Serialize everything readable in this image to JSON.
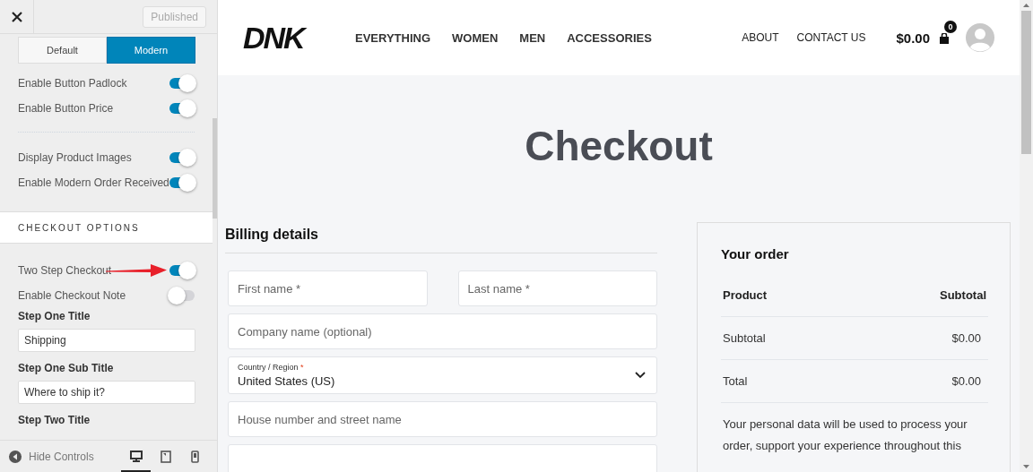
{
  "sidebar": {
    "publish_button": "Published",
    "layout_options": [
      {
        "label": "Default",
        "selected": false
      },
      {
        "label": "Modern",
        "selected": true
      }
    ],
    "settings": [
      {
        "kind": "toggle",
        "label": "Enable Button Padlock",
        "on": true
      },
      {
        "kind": "toggle",
        "label": "Enable Button Price",
        "on": true
      },
      {
        "kind": "divider"
      },
      {
        "kind": "toggle",
        "label": "Display Product Images",
        "on": true
      },
      {
        "kind": "toggle",
        "label": "Enable Modern Order Received",
        "on": true
      },
      {
        "kind": "section",
        "label": "CHECKOUT OPTIONS"
      },
      {
        "kind": "toggle",
        "label": "Two Step Checkout",
        "on": true,
        "annotated": true
      },
      {
        "kind": "toggle",
        "label": "Enable Checkout Note",
        "on": false
      },
      {
        "kind": "text",
        "label": "Step One Title",
        "value": "Shipping"
      },
      {
        "kind": "text",
        "label": "Step One Sub Title",
        "value": "Where to ship it?"
      },
      {
        "kind": "heading",
        "label": "Step Two Title"
      }
    ],
    "footer": {
      "label": "Hide Controls",
      "devices": [
        {
          "kind": "desktop",
          "selected": true
        },
        {
          "kind": "tablet",
          "selected": false
        },
        {
          "kind": "mobile",
          "selected": false
        }
      ]
    }
  },
  "site": {
    "logo": "DNK",
    "nav": [
      "EVERYTHING",
      "WOMEN",
      "MEN",
      "ACCESSORIES"
    ],
    "secondary_nav": [
      "ABOUT",
      "CONTACT US"
    ],
    "cart_total": "$0.00",
    "cart_count": "0"
  },
  "page_title": "Checkout",
  "billing": {
    "title": "Billing details",
    "rows": [
      [
        {
          "kind": "input",
          "placeholder": "First name *"
        },
        {
          "kind": "input",
          "placeholder": "Last name *"
        }
      ],
      [
        {
          "kind": "input",
          "placeholder": "Company name (optional)"
        }
      ],
      [
        {
          "kind": "select",
          "label": "Country / Region",
          "required_mark": "*",
          "value": "United States (US)"
        }
      ],
      [
        {
          "kind": "input",
          "placeholder": "House number and street name"
        }
      ],
      [
        {
          "kind": "input"
        }
      ]
    ]
  },
  "order": {
    "title": "Your order",
    "columns": [
      "Product",
      "Subtotal"
    ],
    "rows": [
      {
        "label": "Subtotal",
        "value": "$0.00"
      },
      {
        "label": "Total",
        "value": "$0.00"
      }
    ],
    "privacy_text": "Your personal data will be used to process your order, support your experience throughout this"
  }
}
